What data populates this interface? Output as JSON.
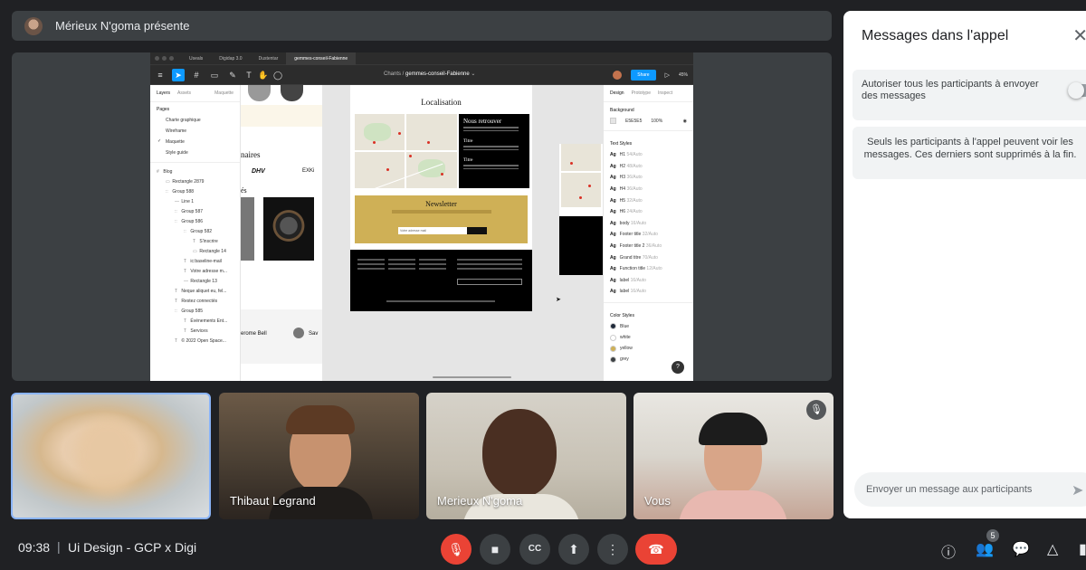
{
  "presenter": {
    "name": "Mérieux N'goma présente"
  },
  "figma": {
    "tabs": [
      "Useals",
      "Digidap 3.0",
      "Dustentar",
      "gemmes-conseil-Fabienne"
    ],
    "breadcrumb_project": "Chants",
    "breadcrumb_file": "gemmes-conseil-Fabienne",
    "share_label": "Share",
    "zoom": "45%",
    "left_tabs": {
      "layers": "Layers",
      "assets": "Assets",
      "page": "Maquette"
    },
    "pages_header": "Pages",
    "pages": [
      "Charte graphique",
      "Wireframe",
      "Maquette",
      "Style guide"
    ],
    "current_page": "Maquette",
    "layers": [
      {
        "indent": 0,
        "icon": "#",
        "label": "Blog"
      },
      {
        "indent": 1,
        "icon": "▭",
        "label": "Rectangle 2879"
      },
      {
        "indent": 1,
        "icon": "::",
        "label": "Group 588"
      },
      {
        "indent": 2,
        "icon": "—",
        "label": "Line 1"
      },
      {
        "indent": 2,
        "icon": "::",
        "label": "Group 587"
      },
      {
        "indent": 2,
        "icon": "::",
        "label": "Group 586"
      },
      {
        "indent": 3,
        "icon": "::",
        "label": "Group 582"
      },
      {
        "indent": 4,
        "icon": "T",
        "label": "S'inscrire"
      },
      {
        "indent": 4,
        "icon": "▭",
        "label": "Rectangle 14"
      },
      {
        "indent": 3,
        "icon": "T",
        "label": "ic:baseline-mail"
      },
      {
        "indent": 3,
        "icon": "T",
        "label": "Votre adresse m..."
      },
      {
        "indent": 3,
        "icon": "—",
        "label": "Rectangle 13"
      },
      {
        "indent": 2,
        "icon": "T",
        "label": "Neque aliquet eu, fel..."
      },
      {
        "indent": 2,
        "icon": "T",
        "label": "Restez connectés"
      },
      {
        "indent": 2,
        "icon": "::",
        "label": "Group 585"
      },
      {
        "indent": 3,
        "icon": "T",
        "label": "Événements Ent..."
      },
      {
        "indent": 3,
        "icon": "T",
        "label": "Services"
      },
      {
        "indent": 2,
        "icon": "T",
        "label": "© 2022 Open Space..."
      }
    ],
    "canvas": {
      "localisation": "Localisation",
      "nous_retrouver": "Nous retrouver",
      "titre1": "Titre",
      "titre2": "Titre",
      "newsletter": "Newsletter",
      "newsletter_input": "Votre adresse mail",
      "partner_text": "naires",
      "brands": [
        "DHV",
        "EXKi"
      ],
      "section_label": "és",
      "person_label": "erome Bell",
      "person2_label": "Sav"
    },
    "right_tabs": {
      "design": "Design",
      "prototype": "Prototype",
      "inspect": "Inspect"
    },
    "background_label": "Background",
    "background_hex": "E5E5E5",
    "background_opacity": "100%",
    "text_styles_label": "Text Styles",
    "text_styles": [
      {
        "name": "H1",
        "spec": "54/Auto"
      },
      {
        "name": "H2",
        "spec": "48/Auto"
      },
      {
        "name": "H3",
        "spec": "36/Auto"
      },
      {
        "name": "H4",
        "spec": "36/Auto"
      },
      {
        "name": "H5",
        "spec": "32/Auto"
      },
      {
        "name": "H6",
        "spec": "24/Auto"
      },
      {
        "name": "body",
        "spec": "16/Auto"
      },
      {
        "name": "Footer title",
        "spec": "32/Auto"
      },
      {
        "name": "Footer title 2",
        "spec": "36/Auto"
      },
      {
        "name": "Grand titre",
        "spec": "70/Auto"
      },
      {
        "name": "Function title",
        "spec": "12/Auto"
      },
      {
        "name": "label",
        "spec": "16/Auto"
      },
      {
        "name": "label",
        "spec": "16/Auto"
      }
    ],
    "color_styles_label": "Color Styles",
    "color_styles": [
      {
        "name": "Blue",
        "color": "#1f2a3a"
      },
      {
        "name": "white",
        "color": "#ffffff"
      },
      {
        "name": "yellow",
        "color": "#cfb056"
      },
      {
        "name": "grey",
        "color": "#3c4043"
      }
    ],
    "help": "?"
  },
  "participants": [
    {
      "name": ""
    },
    {
      "name": "Thibaut Legrand"
    },
    {
      "name": "Merieux N'goma"
    },
    {
      "name": "Vous"
    }
  ],
  "chat": {
    "title": "Messages dans l'appel",
    "allow_label": "Autoriser tous les participants à envoyer des messages",
    "info": "Seuls les participants à l'appel peuvent voir les messages. Ces derniers sont supprimés à la fin.",
    "input_placeholder": "Envoyer un message aux participants"
  },
  "meeting": {
    "time": "09:38",
    "separator": "|",
    "name": "Ui Design - GCP x Digi",
    "participants_count": "5"
  }
}
